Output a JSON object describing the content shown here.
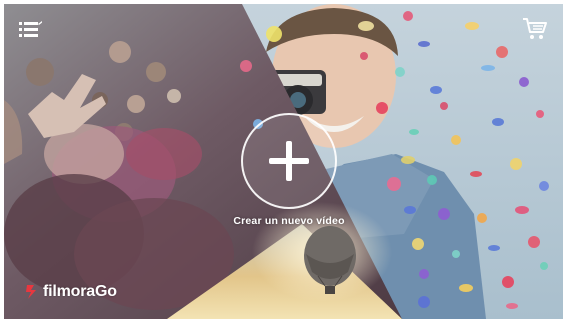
{
  "app": {
    "brand_name": "filmoraGo",
    "brand_color": "#e8373f"
  },
  "topbar": {
    "menu_icon": "list-menu-icon",
    "cart_icon": "shopping-cart-icon"
  },
  "main": {
    "create_label": "Crear un nuevo vídeo",
    "create_icon": "plus-icon"
  },
  "background": {
    "panels": [
      "party-photo",
      "man-with-camera-confetti",
      "hot-air-balloon"
    ]
  }
}
